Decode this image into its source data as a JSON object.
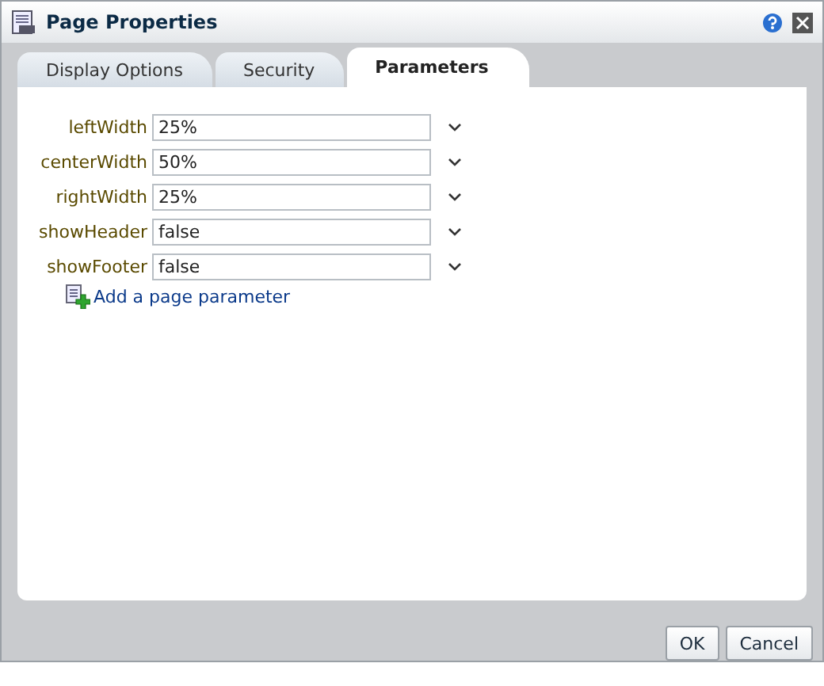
{
  "window": {
    "title": "Page Properties"
  },
  "tabs": [
    {
      "label": "Display Options",
      "selected": false
    },
    {
      "label": "Security",
      "selected": false
    },
    {
      "label": "Parameters",
      "selected": true
    }
  ],
  "parameters": [
    {
      "name": "leftWidth",
      "value": "25%"
    },
    {
      "name": "centerWidth",
      "value": "50%"
    },
    {
      "name": "rightWidth",
      "value": "25%"
    },
    {
      "name": "showHeader",
      "value": "false"
    },
    {
      "name": "showFooter",
      "value": "false"
    }
  ],
  "add_link": "Add a page parameter",
  "buttons": [
    "OK",
    "Cancel"
  ]
}
